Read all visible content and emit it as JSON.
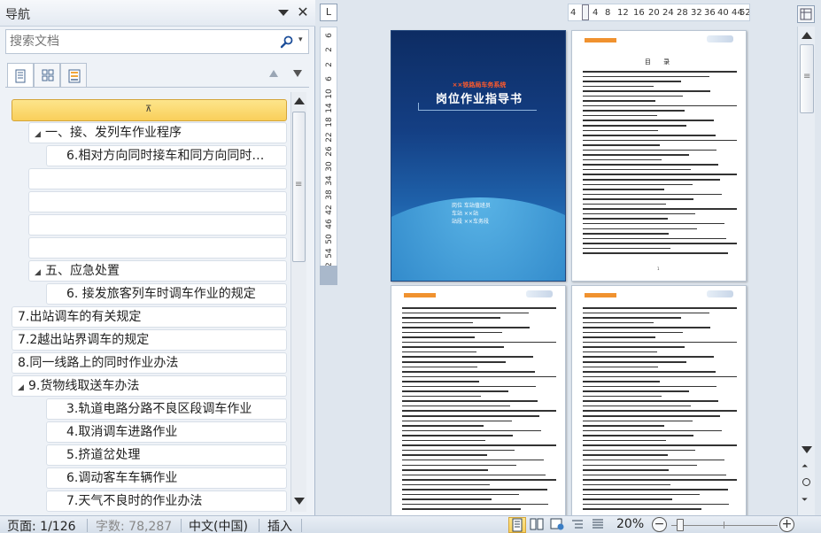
{
  "nav": {
    "title": "导航",
    "close": "✕",
    "search_placeholder": "搜索文档",
    "search_dropdown": "▾",
    "prev_label": "▲",
    "next_label": "▼",
    "collapse_label": "⊼",
    "headings": [
      {
        "label": "一、接、发列车作业程序",
        "level": 1,
        "arrow": "◢"
      },
      {
        "label": "6.相对方向同时接车和同方向同时…",
        "level": 2,
        "arrow": ""
      },
      {
        "label": "",
        "level": 0,
        "arrow": ""
      },
      {
        "label": "",
        "level": 0,
        "arrow": ""
      },
      {
        "label": "",
        "level": 0,
        "arrow": ""
      },
      {
        "label": "",
        "level": 0,
        "arrow": ""
      },
      {
        "label": "五、应急处置",
        "level": 1,
        "arrow": "◢"
      },
      {
        "label": "6. 接发旅客列车时调车作业的规定",
        "level": 2,
        "arrow": ""
      },
      {
        "label": "7.出站调车的有关规定",
        "level": 0,
        "arrow": ""
      },
      {
        "label": "7.2越出站界调车的规定",
        "level": 0,
        "arrow": ""
      },
      {
        "label": "8.同一线路上的同时作业办法",
        "level": 0,
        "arrow": ""
      },
      {
        "label": "9.货物线取送车办法",
        "level": 0,
        "arrow": "◢"
      },
      {
        "label": "3.轨道电路分路不良区段调车作业",
        "level": 2,
        "arrow": ""
      },
      {
        "label": "4.取消调车进路作业",
        "level": 2,
        "arrow": ""
      },
      {
        "label": "5.挤道岔处理",
        "level": 2,
        "arrow": ""
      },
      {
        "label": "6.调动客车车辆作业",
        "level": 2,
        "arrow": ""
      },
      {
        "label": "7.天气不良时的作业办法",
        "level": 2,
        "arrow": ""
      }
    ]
  },
  "rulers": {
    "corner": "L",
    "vertical": [
      "6",
      "2",
      "2",
      "6",
      "10",
      "14",
      "18",
      "22",
      "26",
      "30",
      "34",
      "38",
      "42",
      "46",
      "50",
      "54",
      "62"
    ],
    "horizontal": [
      "4",
      "4",
      "8",
      "12",
      "16",
      "20",
      "24",
      "28",
      "32",
      "36",
      "40",
      "44",
      "52"
    ]
  },
  "document": {
    "cover": {
      "company": "××铁路局车务系统",
      "title": "岗位作业指导书",
      "meta": [
        "岗位  车站值班员",
        "车站    ××站",
        "站段  ××车务段"
      ]
    },
    "toc_title": "目 录",
    "toc_page_num": "1"
  },
  "status": {
    "page": "页面: 1/126",
    "words": "字数: 78,287",
    "language": "中文(中国)",
    "mode": "插入",
    "zoom": "20%",
    "zoom_level": 0.2
  },
  "colors": {
    "cover_top": "#0d2c63",
    "cover_bottom": "#3da2dd",
    "collapse_bar": "#f9cf5a",
    "accent_orange": "#f0922f"
  }
}
